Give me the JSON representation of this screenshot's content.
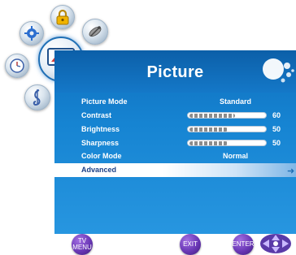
{
  "menu": {
    "title": "Picture",
    "categories": [
      {
        "name": "lock",
        "icon": "lock-icon"
      },
      {
        "name": "setup",
        "icon": "gear-icon"
      },
      {
        "name": "channel",
        "icon": "satellite-dish-icon"
      },
      {
        "name": "time",
        "icon": "clock-icon"
      },
      {
        "name": "picture",
        "icon": "tv-screen-icon",
        "selected": true
      },
      {
        "name": "audio",
        "icon": "music-note-icon"
      }
    ],
    "items": [
      {
        "label": "Picture Mode",
        "value": "Standard"
      },
      {
        "label": "Contrast",
        "value": 60,
        "level": 0.6
      },
      {
        "label": "Brightness",
        "value": 50,
        "level": 0.5
      },
      {
        "label": "Sharpness",
        "value": 50,
        "level": 0.5
      },
      {
        "label": "Color Mode",
        "value": "Normal"
      },
      {
        "label": "Advanced",
        "highlighted": true
      }
    ]
  },
  "hints": {
    "tv_menu_line1": "TV",
    "tv_menu_line2": "MENU",
    "exit": "EXIT",
    "enter": "ENTER"
  },
  "colors": {
    "panel": "#1684d2",
    "header": "#0c5fa8",
    "highlight_text": "#1a3f86",
    "hint_buttons": "#6a38b6"
  }
}
